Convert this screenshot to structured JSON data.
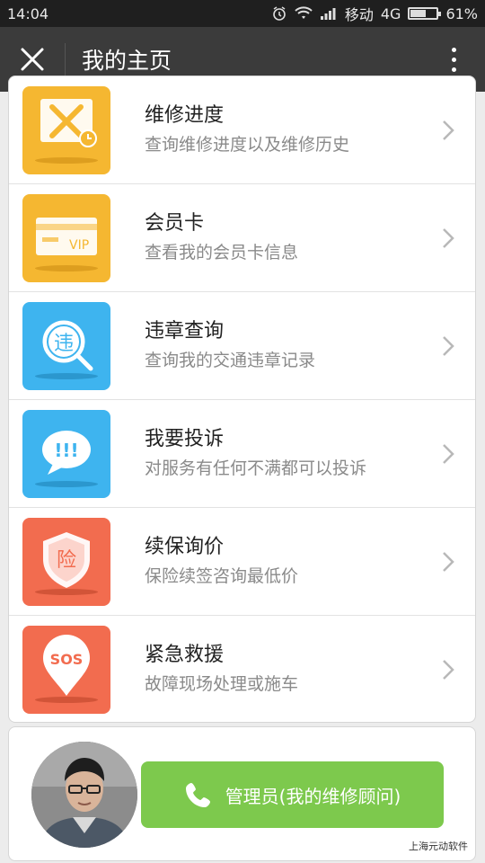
{
  "status_bar": {
    "time": "14:04",
    "carrier": "移动",
    "network": "4G",
    "battery": "61%",
    "battery_level": 0.61
  },
  "header": {
    "title": "我的主页",
    "close_icon": "close-icon",
    "more_icon": "more-vertical-icon"
  },
  "menu": [
    {
      "title": "维修进度",
      "subtitle": "查询维修进度以及维修历史",
      "icon": "repair-tools-icon",
      "color": "#f5b731"
    },
    {
      "title": "会员卡",
      "subtitle": "查看我的会员卡信息",
      "icon": "vip-card-icon",
      "color": "#f5b731"
    },
    {
      "title": "违章查询",
      "subtitle": "查询我的交通违章记录",
      "icon": "violation-search-icon",
      "color": "#3eb4ef"
    },
    {
      "title": "我要投诉",
      "subtitle": "对服务有任何不满都可以投诉",
      "icon": "complaint-bubble-icon",
      "color": "#3eb4ef"
    },
    {
      "title": "续保询价",
      "subtitle": "保险续签咨询最低价",
      "icon": "insurance-shield-icon",
      "color": "#f26c4f"
    },
    {
      "title": "紧急救援",
      "subtitle": "故障现场处理或施车",
      "icon": "sos-pin-icon",
      "color": "#f26c4f"
    }
  ],
  "icon_glyphs": {
    "violation": "违",
    "complaint": "!!!",
    "insurance": "险",
    "sos": "SOS",
    "vip": "VIP"
  },
  "contact": {
    "button_label": "管理员(我的维修顾问)",
    "button_color": "#7dc94d"
  },
  "brand": "上海元动软件"
}
